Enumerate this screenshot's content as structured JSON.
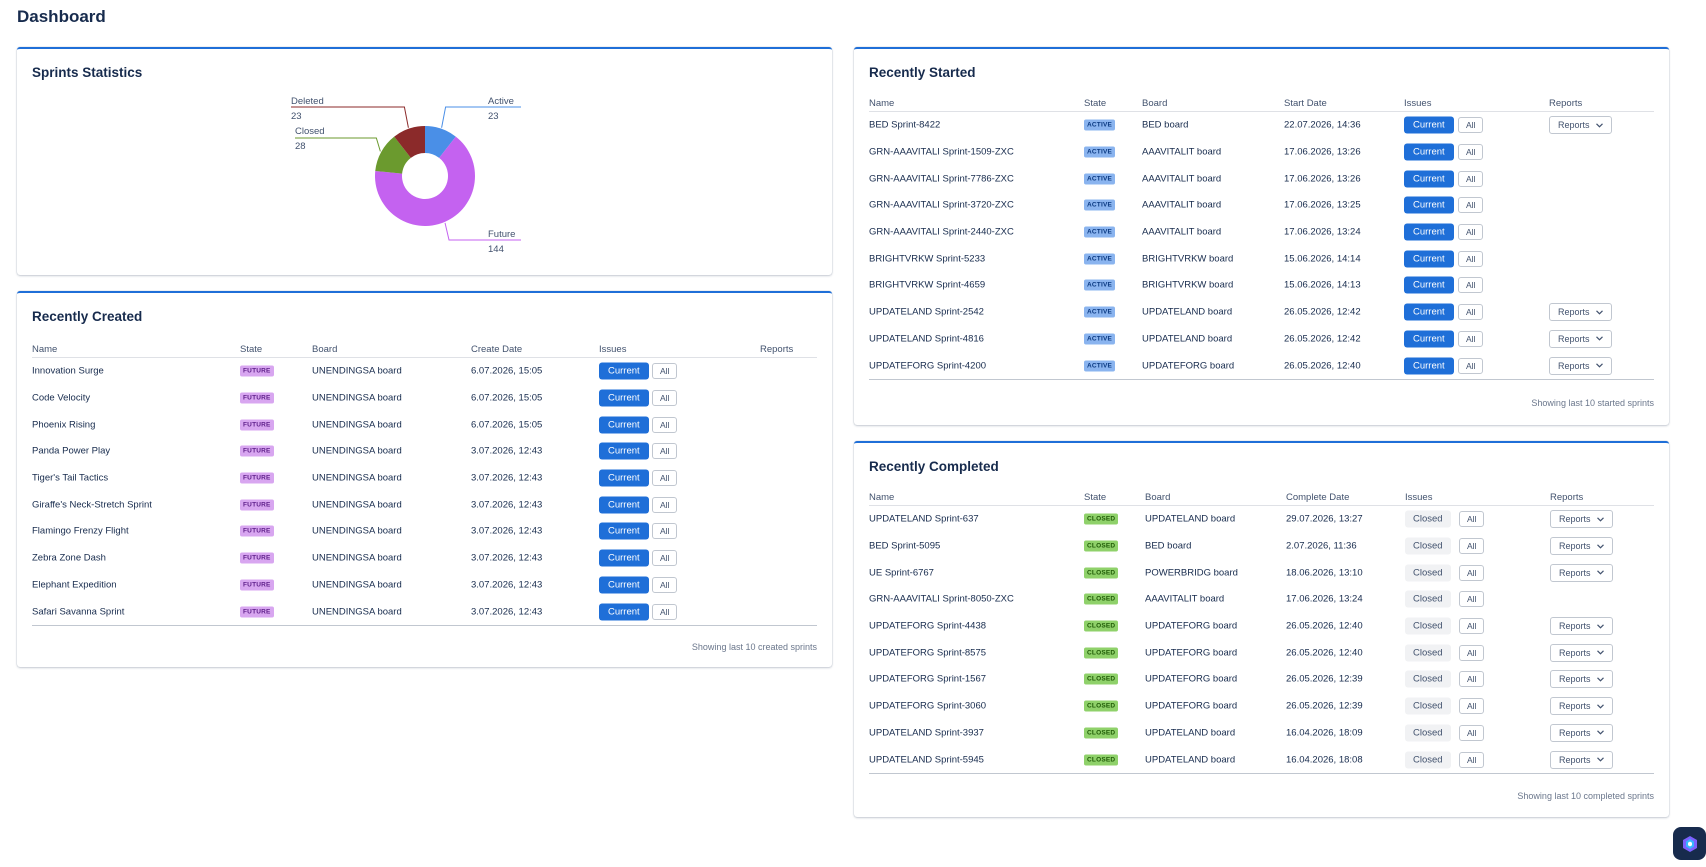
{
  "page_title": "Dashboard",
  "colors": {
    "accent": "#1f6fd8",
    "deleted": "#8b2a2a",
    "active": "#4a8fe7",
    "closed": "#6b9a2e",
    "future": "#c462f0"
  },
  "stats": {
    "title": "Sprints Statistics",
    "slices": [
      {
        "name": "Deleted",
        "value": 23
      },
      {
        "name": "Active",
        "value": 23
      },
      {
        "name": "Closed",
        "value": 28
      },
      {
        "name": "Future",
        "value": 144
      }
    ]
  },
  "created": {
    "title": "Recently Created",
    "headers": {
      "name": "Name",
      "state": "State",
      "board": "Board",
      "date": "Create Date",
      "issues": "Issues",
      "reports": "Reports"
    },
    "rows": [
      {
        "name": "Innovation Surge",
        "state": "FUTURE",
        "board": "UNENDINGSA board",
        "date": "6.07.2026, 15:05",
        "issue": "Current",
        "all": "All"
      },
      {
        "name": "Code Velocity",
        "state": "FUTURE",
        "board": "UNENDINGSA board",
        "date": "6.07.2026, 15:05",
        "issue": "Current",
        "all": "All"
      },
      {
        "name": "Phoenix Rising",
        "state": "FUTURE",
        "board": "UNENDINGSA board",
        "date": "6.07.2026, 15:05",
        "issue": "Current",
        "all": "All"
      },
      {
        "name": "Panda Power Play",
        "state": "FUTURE",
        "board": "UNENDINGSA board",
        "date": "3.07.2026, 12:43",
        "issue": "Current",
        "all": "All"
      },
      {
        "name": "Tiger's Tail Tactics",
        "state": "FUTURE",
        "board": "UNENDINGSA board",
        "date": "3.07.2026, 12:43",
        "issue": "Current",
        "all": "All"
      },
      {
        "name": "Giraffe's Neck-Stretch Sprint",
        "state": "FUTURE",
        "board": "UNENDINGSA board",
        "date": "3.07.2026, 12:43",
        "issue": "Current",
        "all": "All"
      },
      {
        "name": "Flamingo Frenzy Flight",
        "state": "FUTURE",
        "board": "UNENDINGSA board",
        "date": "3.07.2026, 12:43",
        "issue": "Current",
        "all": "All"
      },
      {
        "name": "Zebra Zone Dash",
        "state": "FUTURE",
        "board": "UNENDINGSA board",
        "date": "3.07.2026, 12:43",
        "issue": "Current",
        "all": "All"
      },
      {
        "name": "Elephant Expedition",
        "state": "FUTURE",
        "board": "UNENDINGSA board",
        "date": "3.07.2026, 12:43",
        "issue": "Current",
        "all": "All"
      },
      {
        "name": "Safari Savanna Sprint",
        "state": "FUTURE",
        "board": "UNENDINGSA board",
        "date": "3.07.2026, 12:43",
        "issue": "Current",
        "all": "All"
      }
    ],
    "footer": "Showing last 10 created sprints"
  },
  "started": {
    "title": "Recently Started",
    "headers": {
      "name": "Name",
      "state": "State",
      "board": "Board",
      "date": "Start Date",
      "issues": "Issues",
      "reports": "Reports"
    },
    "rows": [
      {
        "name": "BED Sprint-8422",
        "state": "ACTIVE",
        "board": "BED board",
        "date": "22.07.2026, 14:36",
        "issue": "Current",
        "all": "All",
        "reports": "Reports"
      },
      {
        "name": "GRN-AAAVITALI Sprint-1509-ZXC",
        "state": "ACTIVE",
        "board": "AAAVITALIT board",
        "date": "17.06.2026, 13:26",
        "issue": "Current",
        "all": "All"
      },
      {
        "name": "GRN-AAAVITALI Sprint-7786-ZXC",
        "state": "ACTIVE",
        "board": "AAAVITALIT board",
        "date": "17.06.2026, 13:26",
        "issue": "Current",
        "all": "All"
      },
      {
        "name": "GRN-AAAVITALI Sprint-3720-ZXC",
        "state": "ACTIVE",
        "board": "AAAVITALIT board",
        "date": "17.06.2026, 13:25",
        "issue": "Current",
        "all": "All"
      },
      {
        "name": "GRN-AAAVITALI Sprint-2440-ZXC",
        "state": "ACTIVE",
        "board": "AAAVITALIT board",
        "date": "17.06.2026, 13:24",
        "issue": "Current",
        "all": "All"
      },
      {
        "name": "BRIGHTVRKW Sprint-5233",
        "state": "ACTIVE",
        "board": "BRIGHTVRKW board",
        "date": "15.06.2026, 14:14",
        "issue": "Current",
        "all": "All"
      },
      {
        "name": "BRIGHTVRKW Sprint-4659",
        "state": "ACTIVE",
        "board": "BRIGHTVRKW board",
        "date": "15.06.2026, 14:13",
        "issue": "Current",
        "all": "All"
      },
      {
        "name": "UPDATELAND Sprint-2542",
        "state": "ACTIVE",
        "board": "UPDATELAND board",
        "date": "26.05.2026, 12:42",
        "issue": "Current",
        "all": "All",
        "reports": "Reports"
      },
      {
        "name": "UPDATELAND Sprint-4816",
        "state": "ACTIVE",
        "board": "UPDATELAND board",
        "date": "26.05.2026, 12:42",
        "issue": "Current",
        "all": "All",
        "reports": "Reports"
      },
      {
        "name": "UPDATEFORG Sprint-4200",
        "state": "ACTIVE",
        "board": "UPDATEFORG board",
        "date": "26.05.2026, 12:40",
        "issue": "Current",
        "all": "All",
        "reports": "Reports"
      }
    ],
    "footer": "Showing last 10 started sprints"
  },
  "completed": {
    "title": "Recently Completed",
    "headers": {
      "name": "Name",
      "state": "State",
      "board": "Board",
      "date": "Complete Date",
      "issues": "Issues",
      "reports": "Reports"
    },
    "rows": [
      {
        "name": "UPDATELAND Sprint-637",
        "state": "CLOSED",
        "board": "UPDATELAND board",
        "date": "29.07.2026, 13:27",
        "issue": "Closed",
        "all": "All",
        "reports": "Reports"
      },
      {
        "name": "BED Sprint-5095",
        "state": "CLOSED",
        "board": "BED board",
        "date": "2.07.2026, 11:36",
        "issue": "Closed",
        "all": "All",
        "reports": "Reports"
      },
      {
        "name": "UE Sprint-6767",
        "state": "CLOSED",
        "board": "POWERBRIDG board",
        "date": "18.06.2026, 13:10",
        "issue": "Closed",
        "all": "All",
        "reports": "Reports"
      },
      {
        "name": "GRN-AAAVITALI Sprint-8050-ZXC",
        "state": "CLOSED",
        "board": "AAAVITALIT board",
        "date": "17.06.2026, 13:24",
        "issue": "Closed",
        "all": "All"
      },
      {
        "name": "UPDATEFORG Sprint-4438",
        "state": "CLOSED",
        "board": "UPDATEFORG board",
        "date": "26.05.2026, 12:40",
        "issue": "Closed",
        "all": "All",
        "reports": "Reports"
      },
      {
        "name": "UPDATEFORG Sprint-8575",
        "state": "CLOSED",
        "board": "UPDATEFORG board",
        "date": "26.05.2026, 12:40",
        "issue": "Closed",
        "all": "All",
        "reports": "Reports"
      },
      {
        "name": "UPDATEFORG Sprint-1567",
        "state": "CLOSED",
        "board": "UPDATEFORG board",
        "date": "26.05.2026, 12:39",
        "issue": "Closed",
        "all": "All",
        "reports": "Reports"
      },
      {
        "name": "UPDATEFORG Sprint-3060",
        "state": "CLOSED",
        "board": "UPDATEFORG board",
        "date": "26.05.2026, 12:39",
        "issue": "Closed",
        "all": "All",
        "reports": "Reports"
      },
      {
        "name": "UPDATELAND Sprint-3937",
        "state": "CLOSED",
        "board": "UPDATELAND board",
        "date": "16.04.2026, 18:09",
        "issue": "Closed",
        "all": "All",
        "reports": "Reports"
      },
      {
        "name": "UPDATELAND Sprint-5945",
        "state": "CLOSED",
        "board": "UPDATELAND board",
        "date": "16.04.2026, 18:08",
        "issue": "Closed",
        "all": "All",
        "reports": "Reports"
      }
    ],
    "footer": "Showing last 10 completed sprints"
  },
  "fab_icon": "hexagon-logo-icon"
}
